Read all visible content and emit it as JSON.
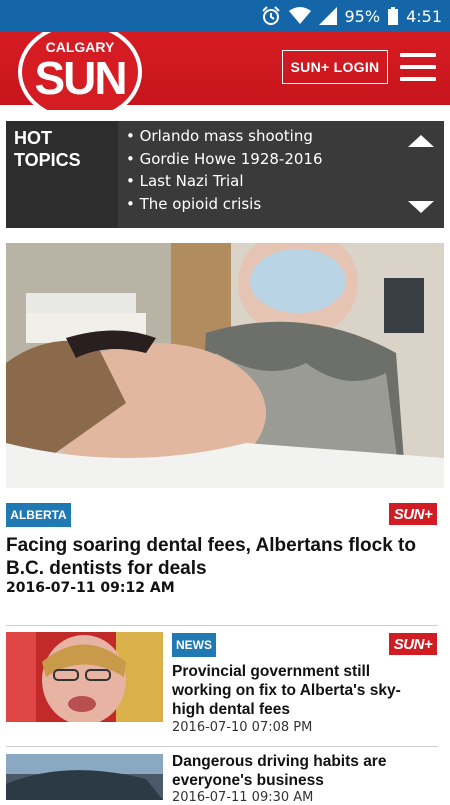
{
  "status_bar": {
    "battery": "95%",
    "time": "4:51",
    "icons": [
      "alarm-icon",
      "wifi-icon",
      "signal-icon",
      "battery-icon"
    ]
  },
  "header": {
    "logo_small": "CALGARY",
    "logo_big": "SUN",
    "login_label": "SUN+ LOGIN",
    "menu_icon": "hamburger-menu-icon",
    "colors": {
      "brand_red": "#d61c23",
      "status_blue": "#1565a9"
    }
  },
  "hot_topics": {
    "label_line1": "HOT",
    "label_line2": "TOPICS",
    "items": [
      "• Orlando mass shooting",
      "• Gordie Howe 1928-2016",
      "• Last Nazi Trial",
      "• The opioid crisis"
    ]
  },
  "main_story": {
    "category": "ALBERTA",
    "badge": "SUN+",
    "title": "Facing soaring dental fees, Albertans flock to B.C. dentists for deals",
    "date": "2016-07-11 09:12 AM"
  },
  "stories": [
    {
      "category": "NEWS",
      "badge": "SUN+",
      "title": "Provincial government still working on fix to Alberta's sky-high dental fees",
      "date": "2016-07-10 07:08 PM"
    },
    {
      "title": "Dangerous driving habits are everyone's business",
      "date": "2016-07-11 09:30 AM"
    }
  ]
}
